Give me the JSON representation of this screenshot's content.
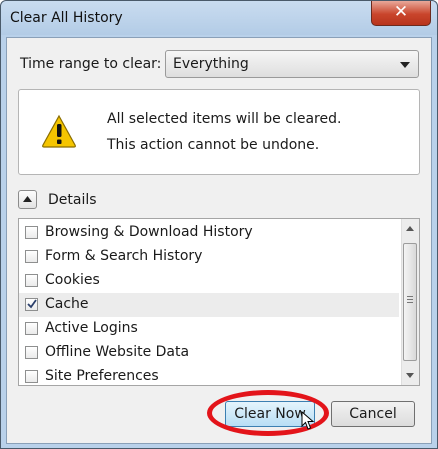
{
  "window": {
    "title": "Clear All History",
    "close_label": "✕"
  },
  "time_range": {
    "label": "Time range to clear:",
    "selected": "Everything"
  },
  "warning": {
    "icon": "warning-icon",
    "line1": "All selected items will be cleared.",
    "line2": "This action cannot be undone."
  },
  "details": {
    "label": "Details",
    "toggle_icon": "chevron-up-icon",
    "expanded": true
  },
  "items": [
    {
      "label": "Browsing & Download History",
      "checked": false
    },
    {
      "label": "Form & Search History",
      "checked": false
    },
    {
      "label": "Cookies",
      "checked": false
    },
    {
      "label": "Cache",
      "checked": true
    },
    {
      "label": "Active Logins",
      "checked": false
    },
    {
      "label": "Offline Website Data",
      "checked": false
    },
    {
      "label": "Site Preferences",
      "checked": false
    }
  ],
  "buttons": {
    "clear_now": "Clear Now",
    "cancel": "Cancel"
  },
  "colors": {
    "annotation_ring": "#e3141a",
    "close_button": "#c9452c",
    "default_button": "#b8def5"
  }
}
